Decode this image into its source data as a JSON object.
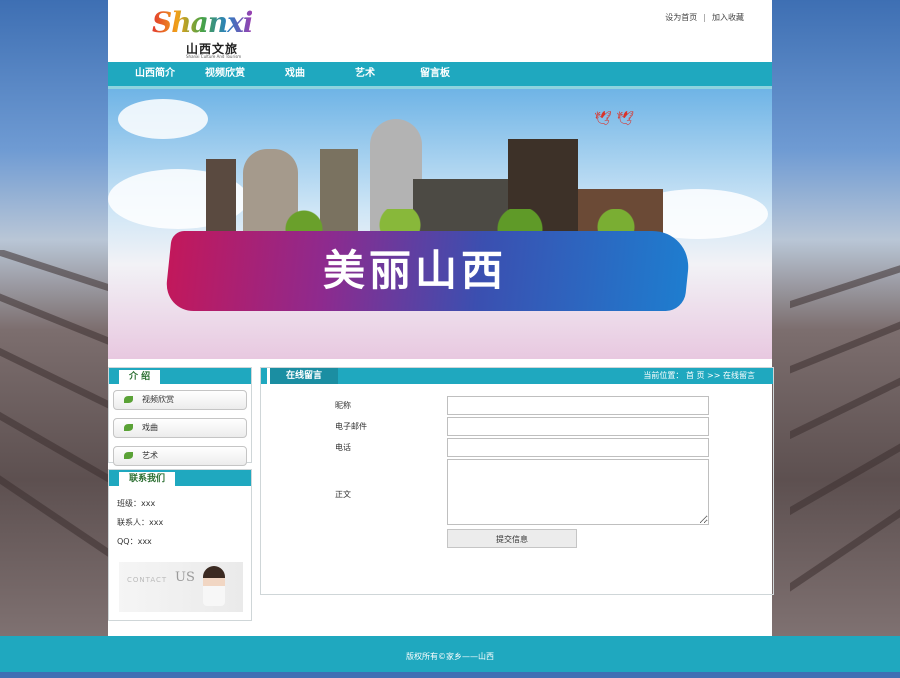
{
  "header": {
    "logo_script": "Shanxi",
    "logo_cn": "山西文旅",
    "logo_en": "Shanxi Culture And Tourism",
    "link_home": "设为首页",
    "link_sep": "|",
    "link_fav": "加入收藏"
  },
  "nav": {
    "items": [
      {
        "label": "山西简介"
      },
      {
        "label": "视频欣赏"
      },
      {
        "label": "戏曲"
      },
      {
        "label": "艺术"
      },
      {
        "label": "留言板"
      }
    ]
  },
  "banner": {
    "slogan": "美丽山西"
  },
  "sidebar": {
    "intro_title": "介 绍",
    "menu": [
      {
        "label": "视频欣赏"
      },
      {
        "label": "戏曲"
      },
      {
        "label": "艺术"
      }
    ],
    "contact_title": "联系我们",
    "contact_lines": [
      "班级：xxx",
      "联系人：xxx",
      "QQ：xxx"
    ],
    "contact_img_word": "CONTACT",
    "contact_img_us": "US"
  },
  "main": {
    "title": "在线留言",
    "breadcrumb_prefix": "当前位置：",
    "breadcrumb_home": "首 页",
    "breadcrumb_sep": ">>",
    "breadcrumb_current": "在线留言",
    "form": {
      "nickname_label": "昵称",
      "email_label": "电子邮件",
      "phone_label": "电话",
      "body_label": "正文",
      "nickname_value": "",
      "email_value": "",
      "phone_value": "",
      "body_value": "",
      "submit_label": "提交信息"
    }
  },
  "footer": {
    "text": "版权所有©家乡——山西"
  },
  "colors": {
    "accent": "#1fa8bf",
    "leaf": "#5aa236",
    "title_green": "#2c6f32"
  }
}
